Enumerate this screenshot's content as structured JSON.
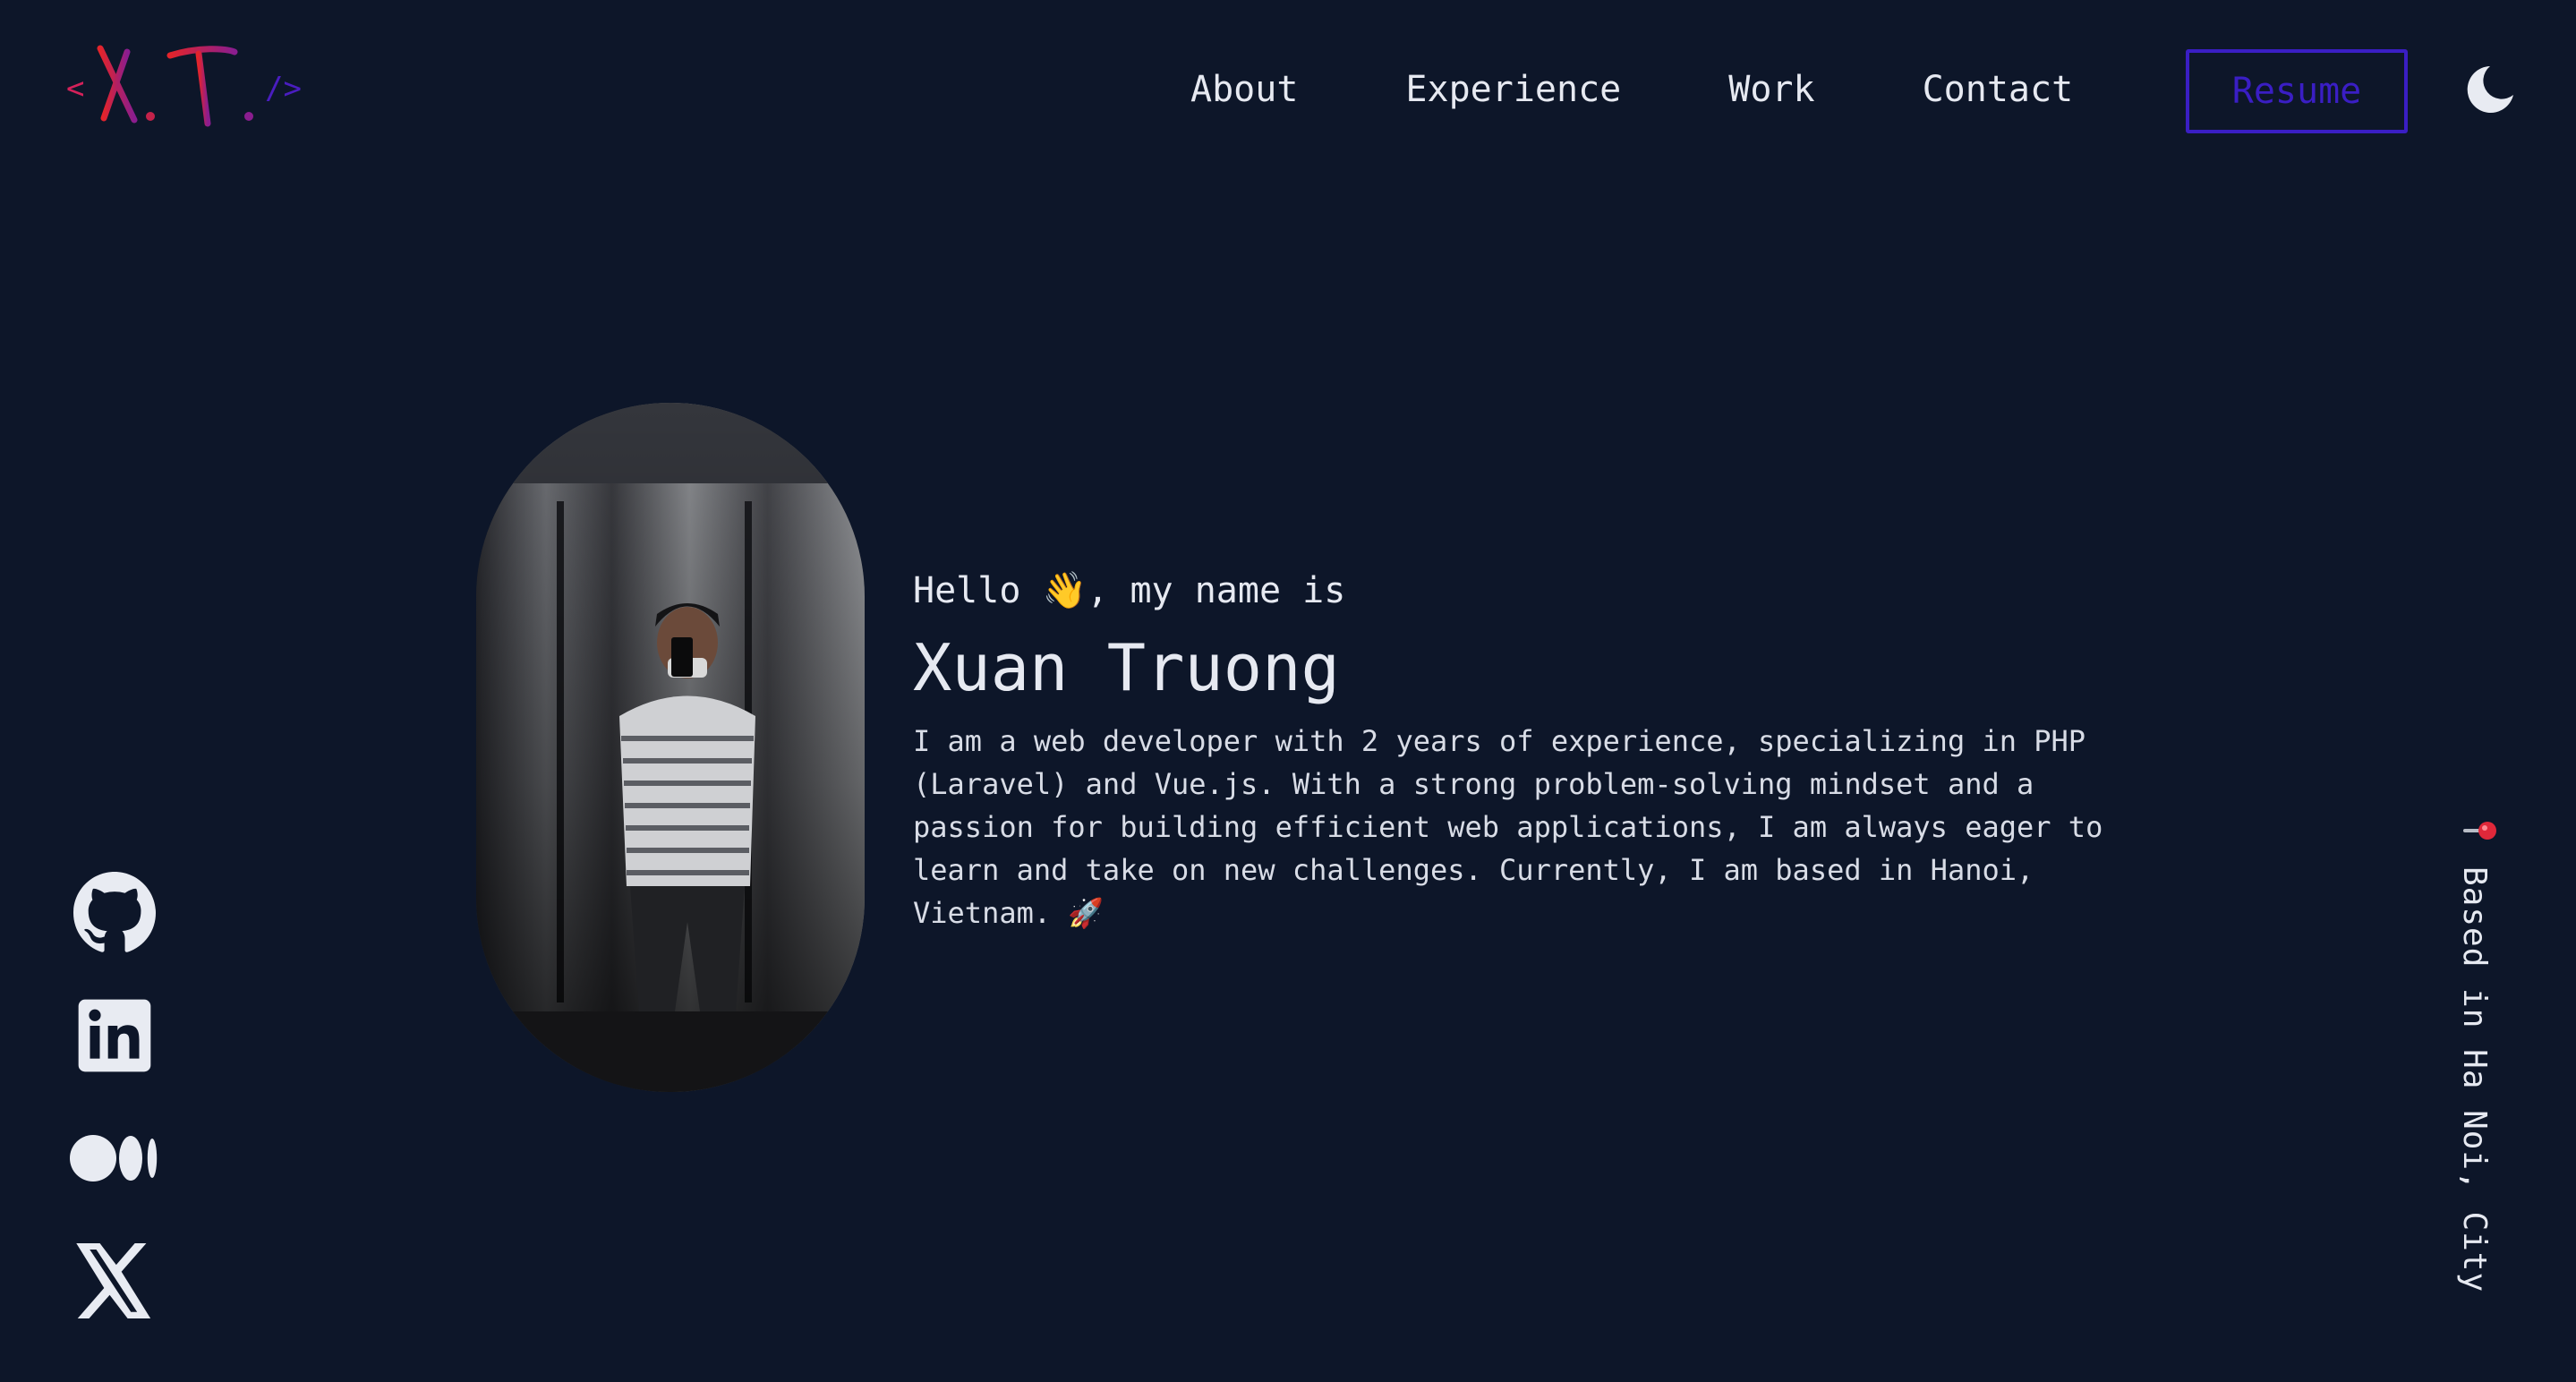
{
  "logo": {
    "open_bracket": "<",
    "initials": "X.T.",
    "close_bracket": "/>",
    "colors": {
      "bracket_left": "#d4215a",
      "initials_start": "#e3242b",
      "initials_end": "#8a1d8f",
      "bracket_right": "#4a1dc0"
    }
  },
  "nav": {
    "links": [
      {
        "label": "About"
      },
      {
        "label": "Experience"
      },
      {
        "label": "Work"
      },
      {
        "label": "Contact"
      }
    ],
    "resume_label": "Resume",
    "theme_icon": "moon-icon"
  },
  "social": [
    {
      "icon": "github-icon"
    },
    {
      "icon": "linkedin-icon"
    },
    {
      "icon": "medium-icon"
    },
    {
      "icon": "x-twitter-icon"
    }
  ],
  "hero": {
    "greeting": "Hello 👋, my name is",
    "name": "Xuan Truong",
    "bio": "I am a web developer with 2 years of experience, specializing in PHP (Laravel) and Vue.js. With a strong problem-solving mindset and a passion for building efficient web applications, I am always eager to learn and take on new challenges. Currently, I am based in Hanoi, Vietnam. 🚀",
    "photo_icon": "profile-photo"
  },
  "location": {
    "text": "Based in Ha Noi, City",
    "icon": "pushpin-icon"
  },
  "colors": {
    "background": "#0d1629",
    "text": "#e6e9f1",
    "accent": "#3a1ec4"
  }
}
